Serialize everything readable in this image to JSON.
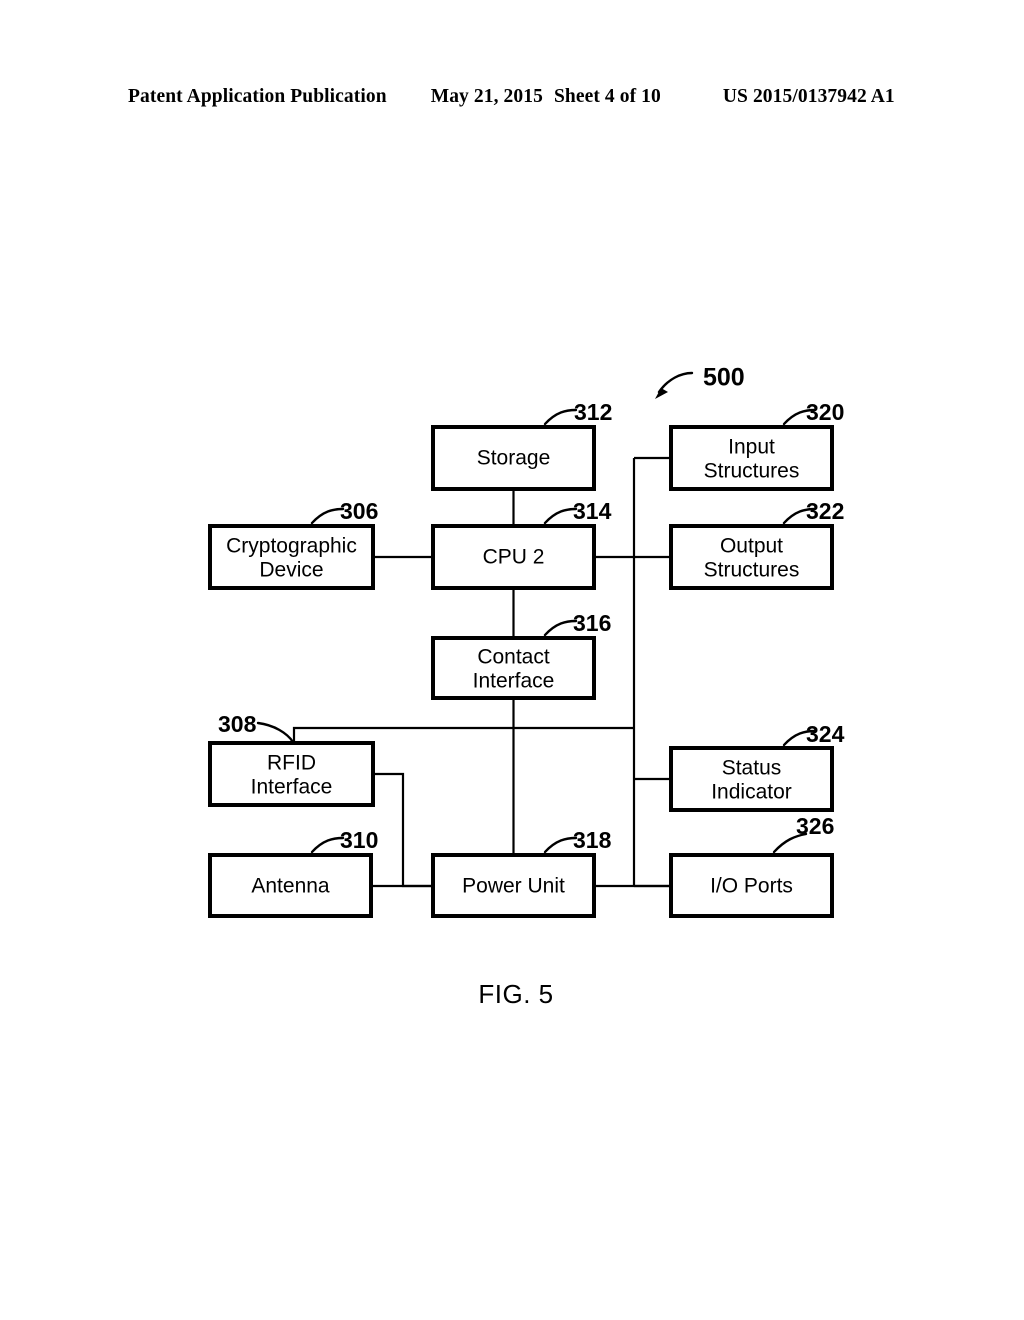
{
  "header": {
    "publication": "Patent Application Publication",
    "date": "May 21, 2015",
    "sheet": "Sheet 4 of 10",
    "patent_number": "US 2015/0137942 A1"
  },
  "figure": {
    "caption": "FIG. 5",
    "system_ref": "500"
  },
  "chart_data": {
    "type": "diagram",
    "title": "FIG. 5",
    "diagram_ref": "500",
    "nodes": [
      {
        "id": "storage",
        "label": "Storage",
        "ref": "312"
      },
      {
        "id": "input",
        "label": "Input\nStructures",
        "ref": "320"
      },
      {
        "id": "crypto",
        "label": "Cryptographic\nDevice",
        "ref": "306"
      },
      {
        "id": "cpu",
        "label": "CPU 2",
        "ref": "314"
      },
      {
        "id": "output",
        "label": "Output\nStructures",
        "ref": "322"
      },
      {
        "id": "contact",
        "label": "Contact\nInterface",
        "ref": "316"
      },
      {
        "id": "rfid",
        "label": "RFID\nInterface",
        "ref": "308"
      },
      {
        "id": "status",
        "label": "Status\nIndicator",
        "ref": "324"
      },
      {
        "id": "antenna",
        "label": "Antenna",
        "ref": "310"
      },
      {
        "id": "power",
        "label": "Power Unit",
        "ref": "318"
      },
      {
        "id": "ioports",
        "label": "I/O Ports",
        "ref": "326"
      }
    ],
    "edges": [
      {
        "from": "storage",
        "to": "cpu"
      },
      {
        "from": "crypto",
        "to": "cpu"
      },
      {
        "from": "cpu",
        "to": "contact"
      },
      {
        "from": "cpu",
        "to": "bus"
      },
      {
        "from": "contact",
        "to": "power"
      },
      {
        "from": "bus",
        "to": "input"
      },
      {
        "from": "bus",
        "to": "output"
      },
      {
        "from": "bus",
        "to": "status"
      },
      {
        "from": "bus",
        "to": "ioports"
      },
      {
        "from": "rfid",
        "to": "bus"
      },
      {
        "from": "rfid",
        "to": "antenna_power_link"
      },
      {
        "from": "antenna",
        "to": "power"
      },
      {
        "from": "power",
        "to": "ioports"
      }
    ]
  },
  "nodes": {
    "storage": {
      "label": "Storage",
      "ref": "312"
    },
    "input": {
      "line1": "Input",
      "line2": "Structures",
      "ref": "320"
    },
    "crypto": {
      "line1": "Cryptographic",
      "line2": "Device",
      "ref": "306"
    },
    "cpu": {
      "label": "CPU 2",
      "ref": "314"
    },
    "output": {
      "line1": "Output",
      "line2": "Structures",
      "ref": "322"
    },
    "contact": {
      "line1": "Contact",
      "line2": "Interface",
      "ref": "316"
    },
    "rfid": {
      "line1": "RFID",
      "line2": "Interface",
      "ref": "308"
    },
    "status": {
      "line1": "Status",
      "line2": "Indicator",
      "ref": "324"
    },
    "antenna": {
      "label": "Antenna",
      "ref": "310"
    },
    "power": {
      "label": "Power Unit",
      "ref": "318"
    },
    "ioports": {
      "label": "I/O Ports",
      "ref": "326"
    }
  },
  "colors": {
    "ink": "#000000",
    "paper": "#ffffff"
  }
}
